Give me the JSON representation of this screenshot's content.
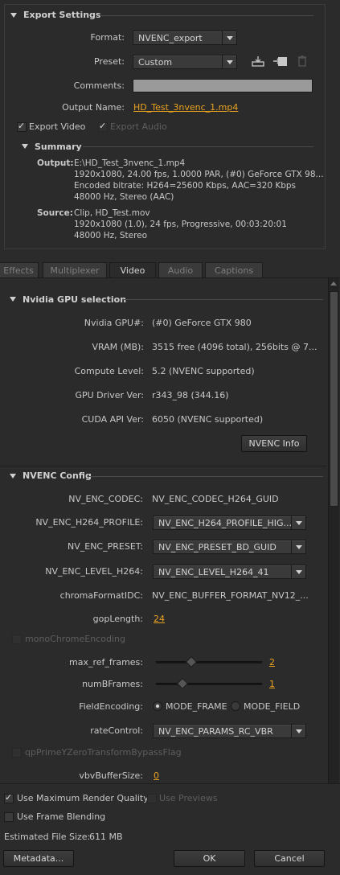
{
  "export_settings": {
    "title": "Export Settings",
    "format_label": "Format:",
    "format_value": "NVENC_export",
    "preset_label": "Preset:",
    "preset_value": "Custom",
    "comments_label": "Comments:",
    "comments_value": "",
    "output_name_label": "Output Name:",
    "output_name_value": "HD_Test_3nvenc_1.mp4",
    "export_video_label": "Export Video",
    "export_video_checked": true,
    "export_audio_label": "Export Audio",
    "export_audio_checked": true
  },
  "summary": {
    "title": "Summary",
    "output_label": "Output:",
    "output_lines": [
      "E:\\HD_Test_3nvenc_1.mp4",
      "1920x1080, 24.00 fps, 1.0000 PAR, (#0) GeForce GTX 98...",
      "Encoded bitrate: H264=25600 Kbps, AAC=320 Kbps",
      "48000 Hz, Stereo (AAC)"
    ],
    "source_label": "Source:",
    "source_lines": [
      "Clip, HD_Test.mov",
      "1920x1080 (1.0), 24 fps, Progressive, 00:03:20:01",
      "48000 Hz, Stereo"
    ]
  },
  "tabs": [
    "Effects",
    "Multiplexer",
    "Video",
    "Audio",
    "Captions"
  ],
  "active_tab": "Video",
  "gpu": {
    "title": "Nvidia GPU selection",
    "rows": [
      {
        "label": "Nvidia GPU#:",
        "value": "(#0) GeForce GTX 980"
      },
      {
        "label": "VRAM (MB):",
        "value": "3515 free (4096 total), 256bits @ 7..."
      },
      {
        "label": "Compute Level:",
        "value": "5.2 (NVENC supported)"
      },
      {
        "label": "GPU Driver Ver:",
        "value": "r343_98  (344.16)"
      },
      {
        "label": "CUDA API Ver:",
        "value": "6050 (NVENC supported)"
      }
    ],
    "info_button": "NVENC Info"
  },
  "nvenc": {
    "title": "NVENC Config",
    "codec_label": "NV_ENC_CODEC:",
    "codec_value": "NV_ENC_CODEC_H264_GUID",
    "profile_label": "NV_ENC_H264_PROFILE:",
    "profile_value": "NV_ENC_H264_PROFILE_HIG...",
    "preset_label": "NV_ENC_PRESET:",
    "preset_value": "NV_ENC_PRESET_BD_GUID",
    "level_label": "NV_ENC_LEVEL_H264:",
    "level_value": "NV_ENC_LEVEL_H264_41",
    "chroma_label": "chromaFormatIDC:",
    "chroma_value": "NV_ENC_BUFFER_FORMAT_NV12_...",
    "gop_label": "gopLength:",
    "gop_value": "24",
    "mono_label": "monoChromeEncoding",
    "maxref_label": "max_ref_frames:",
    "maxref_value": "2",
    "maxref_fraction": 0.33,
    "numb_label": "numBFrames:",
    "numb_value": "1",
    "numb_fraction": 0.25,
    "field_label": "FieldEncoding:",
    "field_opt1": "MODE_FRAME",
    "field_opt2": "MODE_FIELD",
    "rate_label": "rateControl:",
    "rate_value": "NV_ENC_PARAMS_RC_VBR",
    "qp_label": "qpPrimeYZeroTransformBypassFlag",
    "vbv_label": "vbvBufferSize:",
    "vbv_value": "0"
  },
  "bottom": {
    "max_quality_label": "Use Maximum Render Quality",
    "use_previews_label": "Use Previews",
    "frame_blending_label": "Use Frame Blending",
    "est_size_label": "Estimated File Size:",
    "est_size_value": "611 MB",
    "metadata_button": "Metadata...",
    "ok_button": "OK",
    "cancel_button": "Cancel"
  },
  "colors": {
    "accent": "#e9a21f",
    "background": "#2b2b2b"
  }
}
